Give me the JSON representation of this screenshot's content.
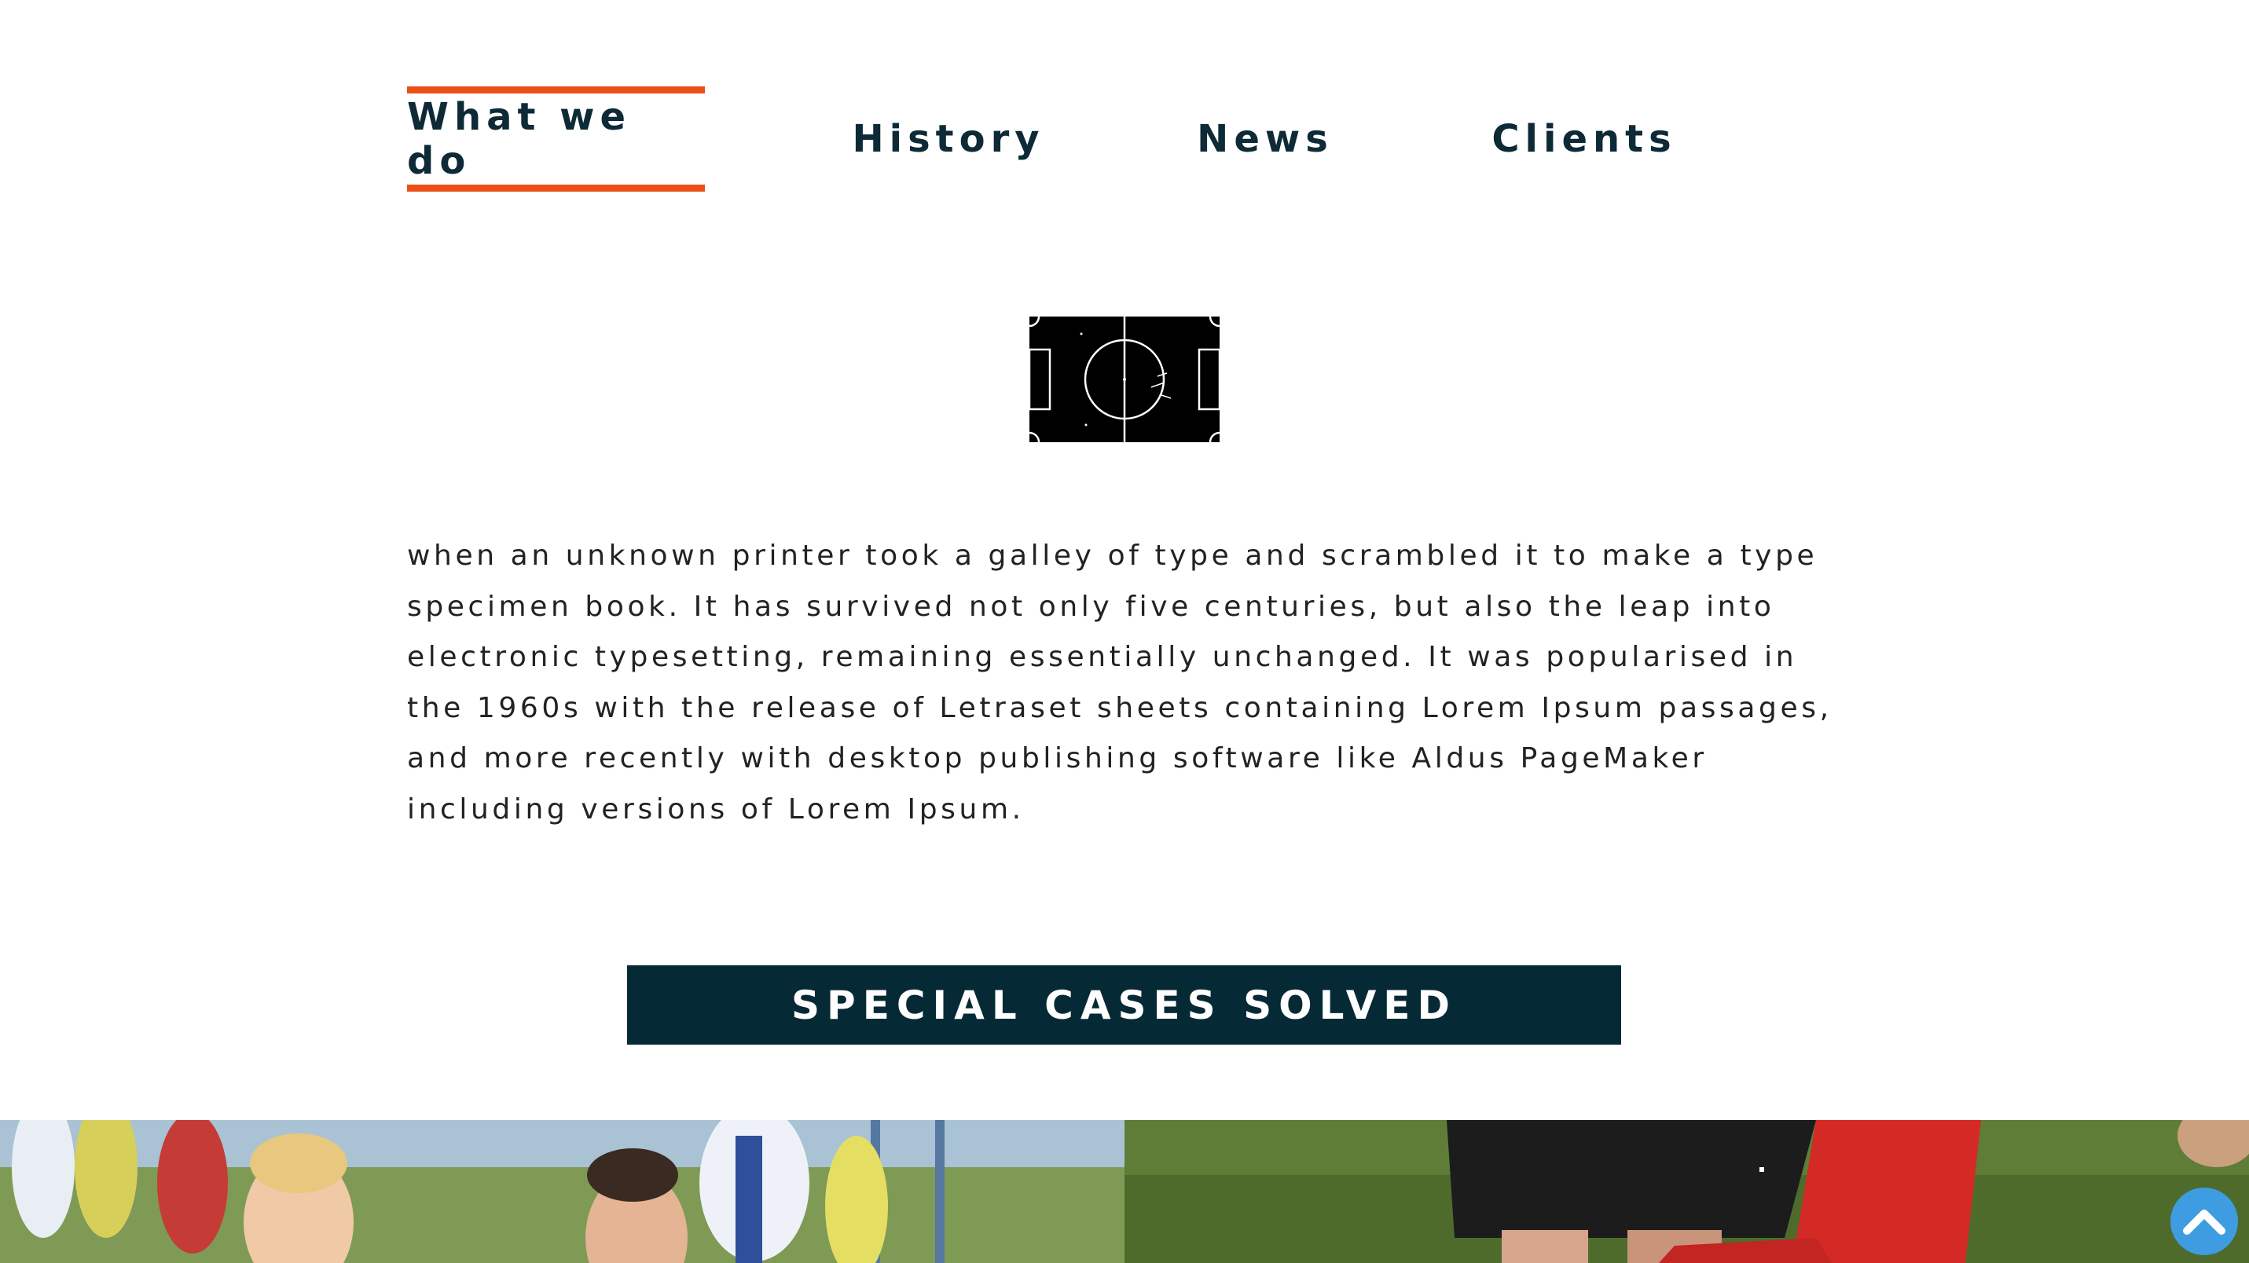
{
  "tabs": [
    {
      "label": "What we do",
      "active": true
    },
    {
      "label": "History",
      "active": false
    },
    {
      "label": "News",
      "active": false
    },
    {
      "label": "Clients",
      "active": false
    }
  ],
  "icon": "soccer-field-icon",
  "body": {
    "paragraph": "when an unknown printer took a galley of type and scrambled it to make a type specimen book. It has survived not only five centuries, but also the leap into electronic typesetting, remaining essentially unchanged. It was popularised in the 1960s with the release of Letraset sheets containing Lorem Ipsum passages, and more recently with desktop publishing software like Aldus PageMaker including versions of Lorem Ipsum."
  },
  "cta": {
    "label": "SPECIAL CASES SOLVED"
  },
  "colors": {
    "accent": "#ec5016",
    "navy": "#052a36",
    "scroll_button": "#3e9de0"
  },
  "scroll_top": {
    "icon": "chevron-up-icon"
  }
}
